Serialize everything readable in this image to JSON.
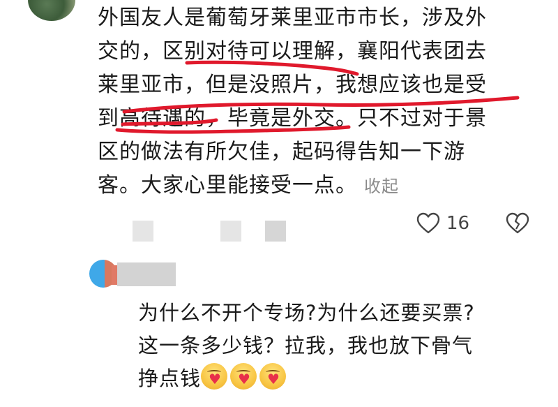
{
  "comment": {
    "lines": [
      "外国友人是葡萄牙莱里亚市市长，涉及外",
      "交的，区别对待可以理解，襄阳代表团去",
      "莱里亚市，但是没照片，我想应该也是受",
      "到高待遇的，毕竟是外交。只不过对于景",
      "区的做法有所欠佳，起码得告知一下游",
      "客。大家心里能接受一点。"
    ],
    "collapse_label": "收起",
    "like_count": "16"
  },
  "reply": {
    "lines": [
      "为什么不开个专场?为什么还要买票?",
      "这一条多少钱？拉我，我也放下骨气",
      "挣点钱"
    ],
    "emoji_count": 3
  },
  "colors": {
    "annotation_red": "#e0192c",
    "muted_gray": "#8a8a8a"
  },
  "icons": [
    "heart-icon",
    "broken-heart-icon"
  ]
}
